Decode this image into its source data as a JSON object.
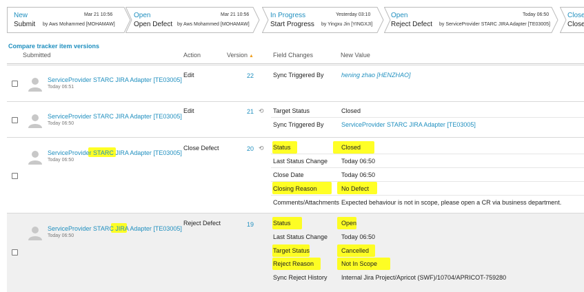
{
  "workflow": [
    {
      "status": "New",
      "action": "Submit",
      "date": "Mar 21 10:56",
      "by": "by Aws Mohammed [MOHAMAW]"
    },
    {
      "status": "Open",
      "action": "Open Defect",
      "date": "Mar 21 10:56",
      "by": "by Aws Mohammed [MOHAMAW]"
    },
    {
      "status": "In Progress",
      "action": "Start Progress",
      "date": "Yesterday 03:10",
      "by": "by Yingxu Jin [YINGXJI]"
    },
    {
      "status": "Open",
      "action": "Reject Defect",
      "date": "Today 06:50",
      "by": "by ServiceProvider STARC JIRA Adapter [TE03005]"
    },
    {
      "status": "Close",
      "action": "Close"
    }
  ],
  "compare_link": "Compare tracker item versions",
  "headers": {
    "submitted": "Submitted",
    "action": "Action",
    "version": "Version",
    "field_changes": "Field Changes",
    "new_value": "New Value"
  },
  "rows": [
    {
      "submitter": "ServiceProvider STARC JIRA Adapter [TE03005]",
      "time": "Today 06:51",
      "action": "Edit",
      "version": "22",
      "changes": [
        {
          "field": "Sync Triggered By",
          "value": "hening zhao [HENZHAO]"
        }
      ]
    },
    {
      "submitter": "ServiceProvider STARC JIRA Adapter [TE03005]",
      "time": "Today 06:50",
      "action": "Edit",
      "version": "21",
      "changes": [
        {
          "field": "Target Status",
          "value": "Closed"
        },
        {
          "field": "Sync Triggered By",
          "value": "ServiceProvider STARC JIRA Adapter [TE03005]"
        }
      ]
    },
    {
      "submitter": "ServiceProvider STARC JIRA Adapter [TE03005]",
      "time": "Today 06:50",
      "action": "Close Defect",
      "version": "20",
      "changes": [
        {
          "field": "Status",
          "value": "Closed"
        },
        {
          "field": "Last Status Change",
          "value": "Today 06:50"
        },
        {
          "field": "Close Date",
          "value": "Today 06:50"
        },
        {
          "field": "Closing Reason",
          "value": "No Defect"
        },
        {
          "field": "Comments/Attachments",
          "value": "Expected behaviour is not in scope, please open a CR via business department."
        }
      ]
    },
    {
      "submitter": "ServiceProvider STARC JIRA Adapter [TE03005]",
      "time": "Today 06:50",
      "action": "Reject Defect",
      "version": "19",
      "changes": [
        {
          "field": "Status",
          "value": "Open"
        },
        {
          "field": "Last Status Change",
          "value": "Today 06:50"
        },
        {
          "field": "Target Status",
          "value": "Cancelled"
        },
        {
          "field": "Reject Reason",
          "value": "Not In Scope"
        },
        {
          "field": "Sync Reject History",
          "value": "Internal Jira Project/Apricot (SWF)/10704/APRICOT-759280"
        }
      ]
    }
  ],
  "colors": {
    "link": "#1f8fbf",
    "highlight": "#ffff00",
    "sort_icon": "#f0a020"
  },
  "icons": {
    "history": "history-icon",
    "sort": "sort-asc-icon",
    "avatar": "avatar-icon"
  }
}
